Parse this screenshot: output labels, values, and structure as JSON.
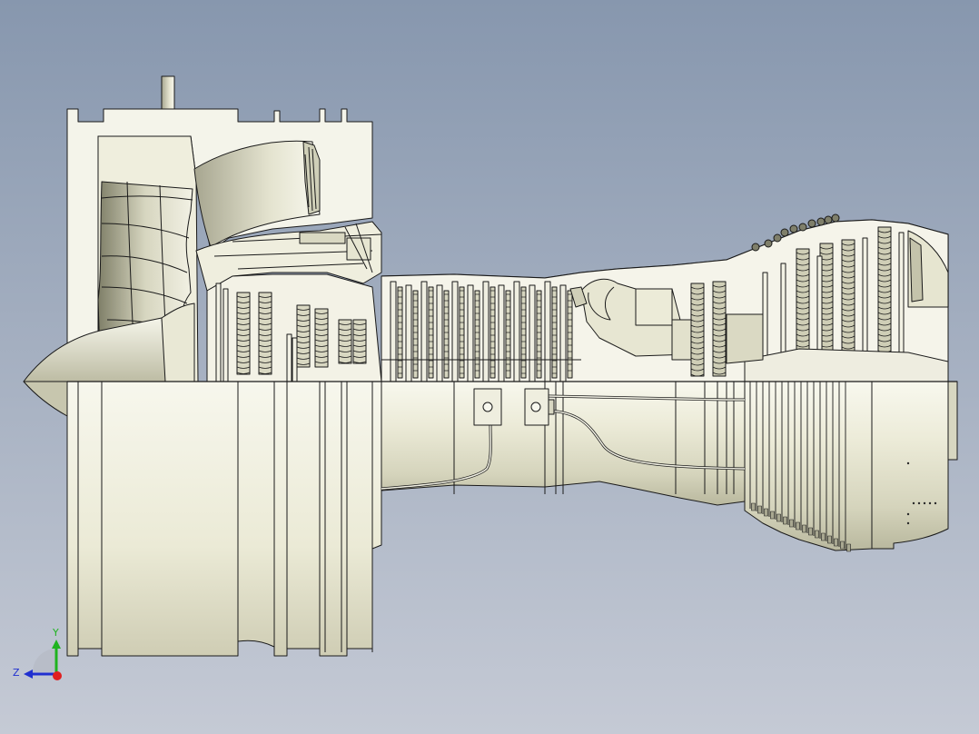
{
  "viewport": {
    "background_top": "#8797ae",
    "background_bottom": "#c5cad5",
    "model_fill_light": "#f6f6ec",
    "model_fill_mid": "#dcdcc6",
    "model_fill_dark": "#8f8f78",
    "edge_color": "#1a1a1a"
  },
  "triad": {
    "y_label": "Y",
    "z_label": "Z",
    "y_color": "#1fb31f",
    "z_color": "#2030d0",
    "x_color": "#e02020"
  }
}
